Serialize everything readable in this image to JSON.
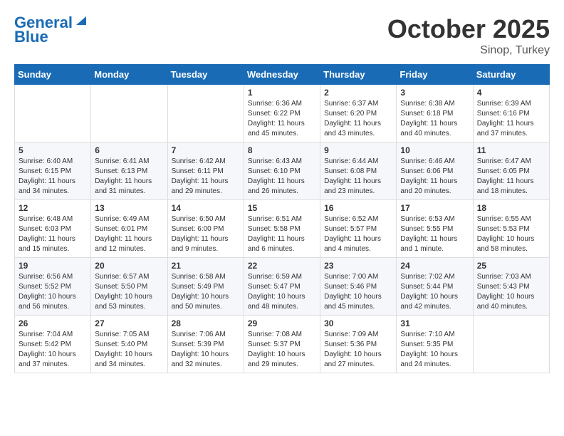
{
  "header": {
    "logo_line1": "General",
    "logo_line2": "Blue",
    "month": "October 2025",
    "location": "Sinop, Turkey"
  },
  "weekdays": [
    "Sunday",
    "Monday",
    "Tuesday",
    "Wednesday",
    "Thursday",
    "Friday",
    "Saturday"
  ],
  "weeks": [
    [
      {
        "day": "",
        "info": ""
      },
      {
        "day": "",
        "info": ""
      },
      {
        "day": "",
        "info": ""
      },
      {
        "day": "1",
        "info": "Sunrise: 6:36 AM\nSunset: 6:22 PM\nDaylight: 11 hours and 45 minutes."
      },
      {
        "day": "2",
        "info": "Sunrise: 6:37 AM\nSunset: 6:20 PM\nDaylight: 11 hours and 43 minutes."
      },
      {
        "day": "3",
        "info": "Sunrise: 6:38 AM\nSunset: 6:18 PM\nDaylight: 11 hours and 40 minutes."
      },
      {
        "day": "4",
        "info": "Sunrise: 6:39 AM\nSunset: 6:16 PM\nDaylight: 11 hours and 37 minutes."
      }
    ],
    [
      {
        "day": "5",
        "info": "Sunrise: 6:40 AM\nSunset: 6:15 PM\nDaylight: 11 hours and 34 minutes."
      },
      {
        "day": "6",
        "info": "Sunrise: 6:41 AM\nSunset: 6:13 PM\nDaylight: 11 hours and 31 minutes."
      },
      {
        "day": "7",
        "info": "Sunrise: 6:42 AM\nSunset: 6:11 PM\nDaylight: 11 hours and 29 minutes."
      },
      {
        "day": "8",
        "info": "Sunrise: 6:43 AM\nSunset: 6:10 PM\nDaylight: 11 hours and 26 minutes."
      },
      {
        "day": "9",
        "info": "Sunrise: 6:44 AM\nSunset: 6:08 PM\nDaylight: 11 hours and 23 minutes."
      },
      {
        "day": "10",
        "info": "Sunrise: 6:46 AM\nSunset: 6:06 PM\nDaylight: 11 hours and 20 minutes."
      },
      {
        "day": "11",
        "info": "Sunrise: 6:47 AM\nSunset: 6:05 PM\nDaylight: 11 hours and 18 minutes."
      }
    ],
    [
      {
        "day": "12",
        "info": "Sunrise: 6:48 AM\nSunset: 6:03 PM\nDaylight: 11 hours and 15 minutes."
      },
      {
        "day": "13",
        "info": "Sunrise: 6:49 AM\nSunset: 6:01 PM\nDaylight: 11 hours and 12 minutes."
      },
      {
        "day": "14",
        "info": "Sunrise: 6:50 AM\nSunset: 6:00 PM\nDaylight: 11 hours and 9 minutes."
      },
      {
        "day": "15",
        "info": "Sunrise: 6:51 AM\nSunset: 5:58 PM\nDaylight: 11 hours and 6 minutes."
      },
      {
        "day": "16",
        "info": "Sunrise: 6:52 AM\nSunset: 5:57 PM\nDaylight: 11 hours and 4 minutes."
      },
      {
        "day": "17",
        "info": "Sunrise: 6:53 AM\nSunset: 5:55 PM\nDaylight: 11 hours and 1 minute."
      },
      {
        "day": "18",
        "info": "Sunrise: 6:55 AM\nSunset: 5:53 PM\nDaylight: 10 hours and 58 minutes."
      }
    ],
    [
      {
        "day": "19",
        "info": "Sunrise: 6:56 AM\nSunset: 5:52 PM\nDaylight: 10 hours and 56 minutes."
      },
      {
        "day": "20",
        "info": "Sunrise: 6:57 AM\nSunset: 5:50 PM\nDaylight: 10 hours and 53 minutes."
      },
      {
        "day": "21",
        "info": "Sunrise: 6:58 AM\nSunset: 5:49 PM\nDaylight: 10 hours and 50 minutes."
      },
      {
        "day": "22",
        "info": "Sunrise: 6:59 AM\nSunset: 5:47 PM\nDaylight: 10 hours and 48 minutes."
      },
      {
        "day": "23",
        "info": "Sunrise: 7:00 AM\nSunset: 5:46 PM\nDaylight: 10 hours and 45 minutes."
      },
      {
        "day": "24",
        "info": "Sunrise: 7:02 AM\nSunset: 5:44 PM\nDaylight: 10 hours and 42 minutes."
      },
      {
        "day": "25",
        "info": "Sunrise: 7:03 AM\nSunset: 5:43 PM\nDaylight: 10 hours and 40 minutes."
      }
    ],
    [
      {
        "day": "26",
        "info": "Sunrise: 7:04 AM\nSunset: 5:42 PM\nDaylight: 10 hours and 37 minutes."
      },
      {
        "day": "27",
        "info": "Sunrise: 7:05 AM\nSunset: 5:40 PM\nDaylight: 10 hours and 34 minutes."
      },
      {
        "day": "28",
        "info": "Sunrise: 7:06 AM\nSunset: 5:39 PM\nDaylight: 10 hours and 32 minutes."
      },
      {
        "day": "29",
        "info": "Sunrise: 7:08 AM\nSunset: 5:37 PM\nDaylight: 10 hours and 29 minutes."
      },
      {
        "day": "30",
        "info": "Sunrise: 7:09 AM\nSunset: 5:36 PM\nDaylight: 10 hours and 27 minutes."
      },
      {
        "day": "31",
        "info": "Sunrise: 7:10 AM\nSunset: 5:35 PM\nDaylight: 10 hours and 24 minutes."
      },
      {
        "day": "",
        "info": ""
      }
    ]
  ]
}
